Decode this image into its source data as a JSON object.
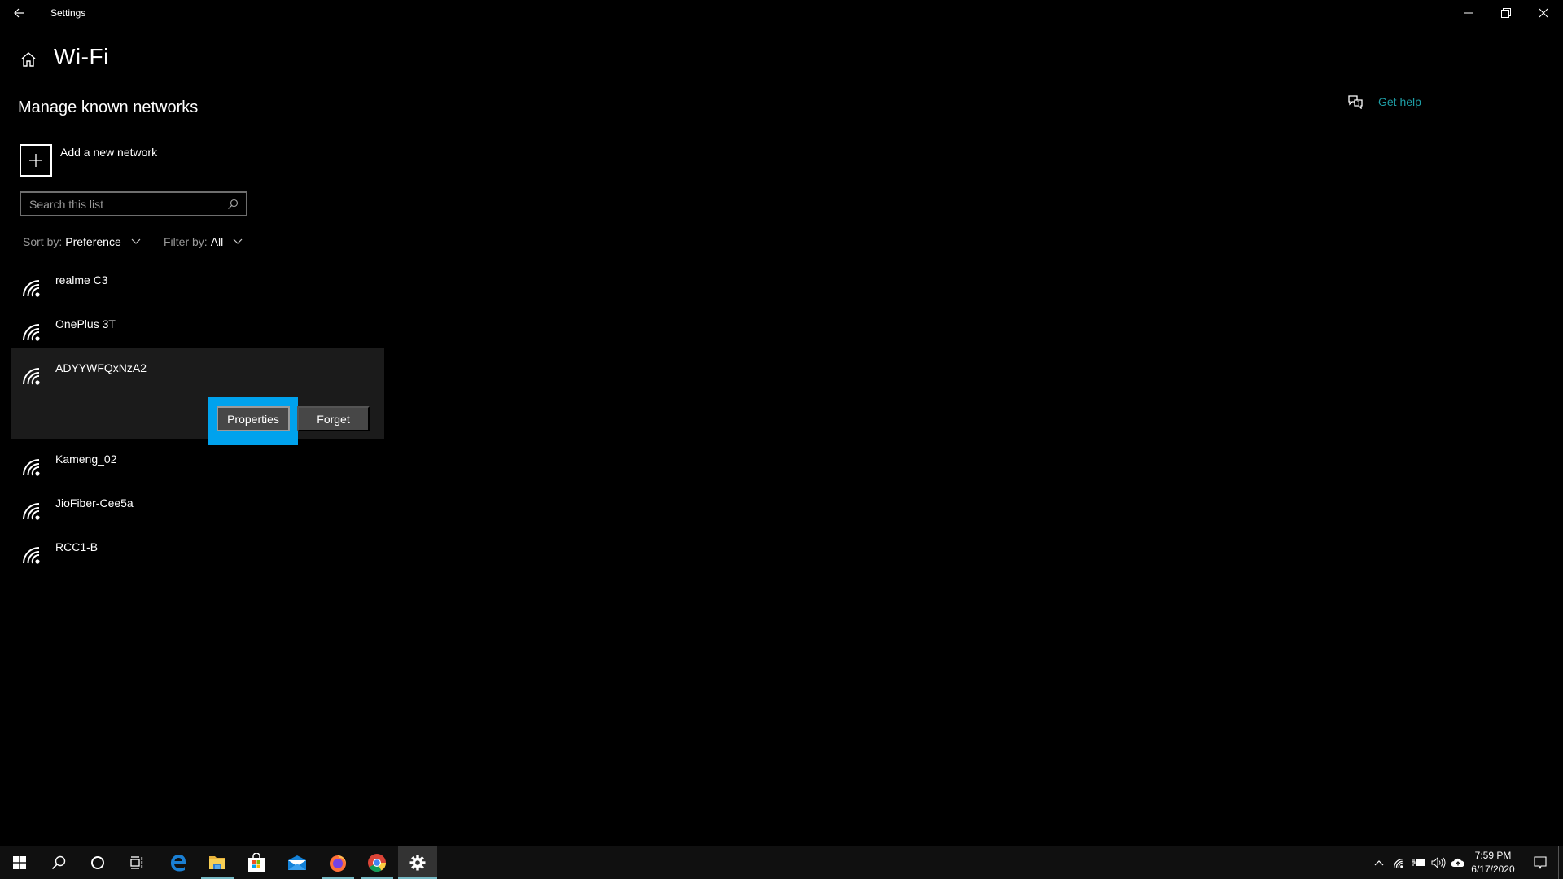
{
  "window": {
    "app_title": "Settings",
    "back_label": "Back",
    "controls": {
      "minimize": "Minimize",
      "restore": "Restore",
      "close": "Close"
    }
  },
  "header": {
    "page_title": "Wi-Fi",
    "section_title": "Manage known networks",
    "get_help_label": "Get help"
  },
  "add_network": {
    "label": "Add a new network"
  },
  "search": {
    "placeholder": "Search this list",
    "value": ""
  },
  "sort": {
    "label": "Sort by:",
    "value": "Preference"
  },
  "filter": {
    "label": "Filter by:",
    "value": "All"
  },
  "networks": [
    {
      "name": "realme C3",
      "icon": "wifi-icon"
    },
    {
      "name": "OnePlus 3T",
      "icon": "wifi-icon"
    },
    {
      "name": "ADYYWFQxNzA2",
      "icon": "wifi-icon",
      "expanded": true
    },
    {
      "name": "Kameng_02",
      "icon": "wifi-icon"
    },
    {
      "name": "JioFiber-Cee5a",
      "icon": "wifi-icon"
    },
    {
      "name": "RCC1-B",
      "icon": "wifi-icon"
    }
  ],
  "network_actions": {
    "properties_label": "Properties",
    "forget_label": "Forget"
  },
  "colors": {
    "accent": "#00a2ed",
    "link": "#1e9ea6",
    "selected_bg": "#1b1b1b",
    "taskbar_bg": "#101010"
  },
  "taskbar": {
    "apps": [
      {
        "name": "start",
        "icon": "windows-logo-icon"
      },
      {
        "name": "search",
        "icon": "search-icon"
      },
      {
        "name": "cortana",
        "icon": "cortana-circle-icon"
      },
      {
        "name": "task-view",
        "icon": "task-view-icon"
      },
      {
        "name": "edge",
        "icon": "edge-icon"
      },
      {
        "name": "file-explorer",
        "icon": "folder-icon",
        "running": true
      },
      {
        "name": "store",
        "icon": "store-bag-icon"
      },
      {
        "name": "mail",
        "icon": "mail-icon"
      },
      {
        "name": "firefox",
        "icon": "firefox-icon",
        "running": true
      },
      {
        "name": "chrome",
        "icon": "chrome-icon",
        "running": true
      },
      {
        "name": "settings",
        "icon": "gear-icon",
        "running": true,
        "active": true
      }
    ],
    "tray": {
      "time": "7:59 PM",
      "date": "6/17/2020",
      "icons": [
        "chevron-up-icon",
        "wifi-icon",
        "battery-charging-icon",
        "volume-icon",
        "onedrive-icon"
      ]
    }
  }
}
